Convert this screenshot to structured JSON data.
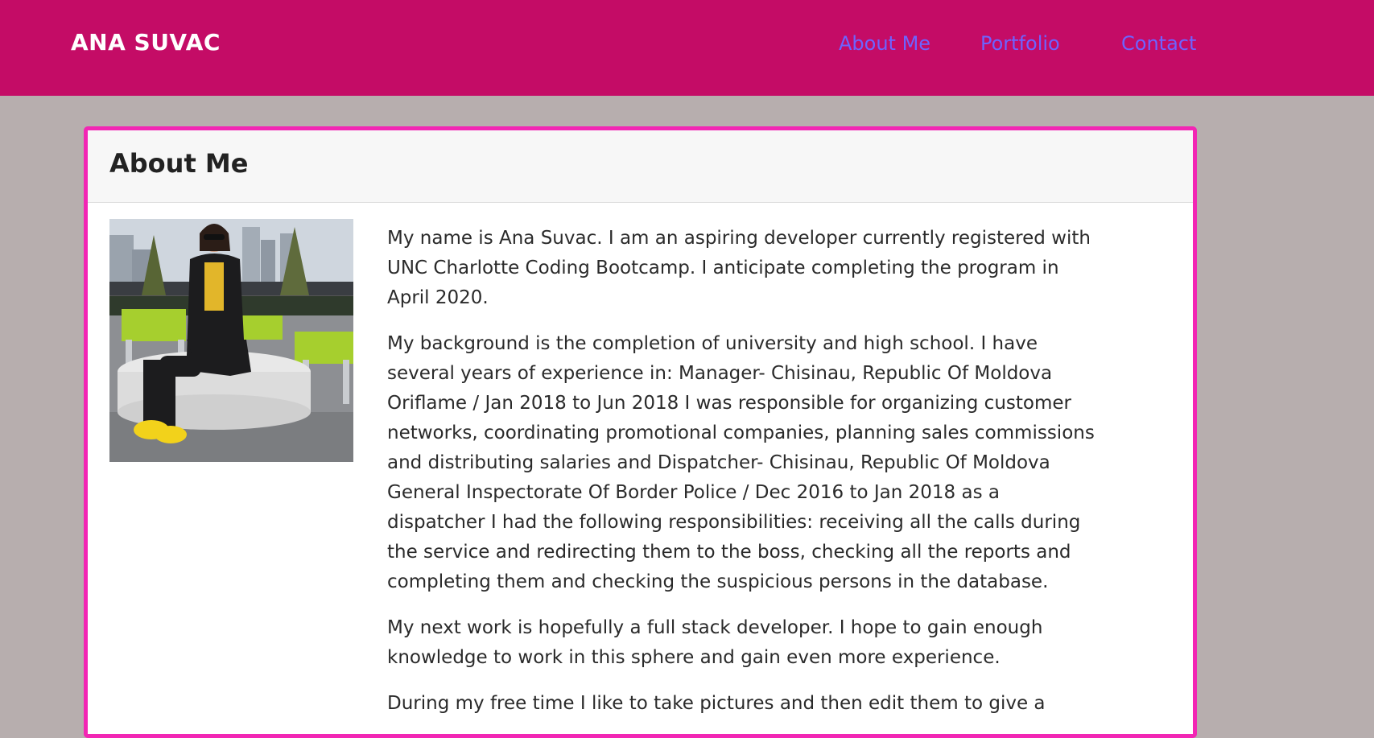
{
  "header": {
    "brand": "ANA SUVAC",
    "nav": {
      "about": "About Me",
      "portfolio": "Portfolio",
      "contact": "Contact"
    }
  },
  "card": {
    "title": "About Me",
    "paragraphs": [
      "My name is Ana Suvac. I am an aspiring developer currently registered with UNC Charlotte Coding Bootcamp. I anticipate completing the program in April 2020.",
      "My background is the completion of university and high school. I have several years of experience in: Manager-  Chisinau, Republic Of Moldova Oriflame / Jan 2018 to Jun 2018  I was responsible for organizing customer networks, coordinating promotional companies, planning sales commissions and distributing salaries and Dispatcher-  Chisinau, Republic Of Moldova General Inspectorate Of Border Police / Dec 2016 to Jan 2018  as a dispatcher I had the following responsibilities: receiving all the calls during the service and redirecting them to the boss, checking all the reports and completing them and checking the suspicious persons in the database.",
      "My next work is hopefully a full stack developer. I hope to gain enough knowledge to work in this sphere and gain even more experience.",
      "During my free time I like to take pictures and then edit them to give a"
    ]
  },
  "colors": {
    "navbar": "#c40c66",
    "nav_link": "#6d63ff",
    "page_bg": "#b7aeae",
    "card_border": "#f226b4"
  }
}
